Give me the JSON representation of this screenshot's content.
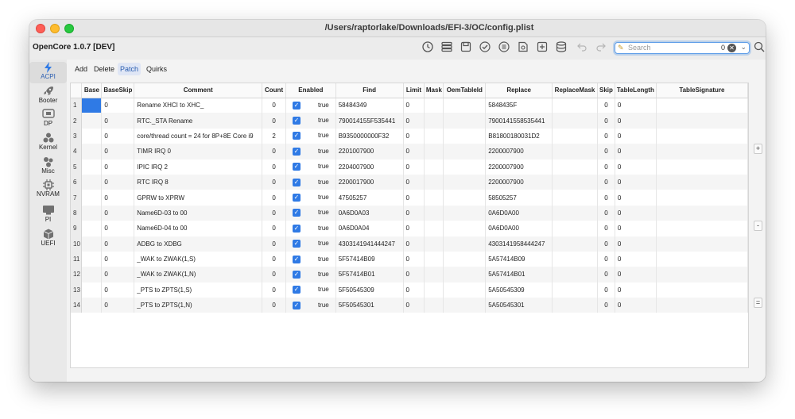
{
  "window": {
    "title": "/Users/raptorlake/Downloads/EFI-3/OC/config.plist"
  },
  "toolbar": {
    "app_name": "OpenCore 1.0.7 [DEV]",
    "icons": [
      "clock-icon",
      "list-icon",
      "save-icon",
      "check-icon",
      "list-circle-icon",
      "document-icon",
      "new-document-icon",
      "database-icon",
      "undo-icon",
      "redo-icon"
    ],
    "search_placeholder": "Search",
    "search_count": "0"
  },
  "sidebar": {
    "items": [
      {
        "label": "ACPI",
        "icon": "lightning-icon",
        "active": true
      },
      {
        "label": "Booter",
        "icon": "rocket-icon",
        "active": false
      },
      {
        "label": "DP",
        "icon": "device-icon",
        "active": false
      },
      {
        "label": "Kernel",
        "icon": "kernel-icon",
        "active": false
      },
      {
        "label": "Misc",
        "icon": "misc-icon",
        "active": false
      },
      {
        "label": "NVRAM",
        "icon": "chip-icon",
        "active": false
      },
      {
        "label": "PI",
        "icon": "platform-icon",
        "active": false
      },
      {
        "label": "UEFI",
        "icon": "cube-icon",
        "active": false
      }
    ]
  },
  "tabs": [
    {
      "label": "Add",
      "active": false
    },
    {
      "label": "Delete",
      "active": false
    },
    {
      "label": "Patch",
      "active": true
    },
    {
      "label": "Quirks",
      "active": false
    }
  ],
  "table": {
    "headers": [
      "",
      "Base",
      "BaseSkip",
      "Comment",
      "Count",
      "Enabled",
      "Find",
      "Limit",
      "Mask",
      "OemTableId",
      "Replace",
      "ReplaceMask",
      "Skip",
      "TableLength",
      "TableSignature"
    ],
    "rows": [
      {
        "n": "1",
        "base": "",
        "baseskip": "0",
        "comment": "Rename XHCI to XHC_",
        "count": "0",
        "enabled": "true",
        "find": "58484349",
        "limit": "0",
        "replace": "5848435F",
        "skip": "0",
        "tablelength": "0"
      },
      {
        "n": "2",
        "base": "",
        "baseskip": "0",
        "comment": "RTC._STA Rename",
        "count": "0",
        "enabled": "true",
        "find": "790014155F535441",
        "limit": "0",
        "replace": "7900141558535441",
        "skip": "0",
        "tablelength": "0"
      },
      {
        "n": "3",
        "base": "",
        "baseskip": "0",
        "comment": "core/thread count = 24 for 8P+8E Core i9",
        "count": "2",
        "enabled": "true",
        "find": "B9350000000F32",
        "limit": "0",
        "replace": "B81800180031D2",
        "skip": "0",
        "tablelength": "0"
      },
      {
        "n": "4",
        "base": "",
        "baseskip": "0",
        "comment": "TIMR IRQ 0",
        "count": "0",
        "enabled": "true",
        "find": "2201007900",
        "limit": "0",
        "replace": "2200007900",
        "skip": "0",
        "tablelength": "0"
      },
      {
        "n": "5",
        "base": "",
        "baseskip": "0",
        "comment": "IPIC IRQ 2",
        "count": "0",
        "enabled": "true",
        "find": "2204007900",
        "limit": "0",
        "replace": "2200007900",
        "skip": "0",
        "tablelength": "0"
      },
      {
        "n": "6",
        "base": "",
        "baseskip": "0",
        "comment": "RTC IRQ 8",
        "count": "0",
        "enabled": "true",
        "find": "2200017900",
        "limit": "0",
        "replace": "2200007900",
        "skip": "0",
        "tablelength": "0"
      },
      {
        "n": "7",
        "base": "",
        "baseskip": "0",
        "comment": "GPRW to XPRW",
        "count": "0",
        "enabled": "true",
        "find": "47505257",
        "limit": "0",
        "replace": "58505257",
        "skip": "0",
        "tablelength": "0"
      },
      {
        "n": "8",
        "base": "",
        "baseskip": "0",
        "comment": "Name6D-03 to 00",
        "count": "0",
        "enabled": "true",
        "find": "0A6D0A03",
        "limit": "0",
        "replace": "0A6D0A00",
        "skip": "0",
        "tablelength": "0"
      },
      {
        "n": "9",
        "base": "",
        "baseskip": "0",
        "comment": "Name6D-04 to 00",
        "count": "0",
        "enabled": "true",
        "find": "0A6D0A04",
        "limit": "0",
        "replace": "0A6D0A00",
        "skip": "0",
        "tablelength": "0"
      },
      {
        "n": "10",
        "base": "",
        "baseskip": "0",
        "comment": "ADBG to XDBG",
        "count": "0",
        "enabled": "true",
        "find": "4303141941444247",
        "limit": "0",
        "replace": "4303141958444247",
        "skip": "0",
        "tablelength": "0"
      },
      {
        "n": "11",
        "base": "",
        "baseskip": "0",
        "comment": "_WAK to ZWAK(1,S)",
        "count": "0",
        "enabled": "true",
        "find": "5F57414B09",
        "limit": "0",
        "replace": "5A57414B09",
        "skip": "0",
        "tablelength": "0"
      },
      {
        "n": "12",
        "base": "",
        "baseskip": "0",
        "comment": "_WAK to ZWAK(1,N)",
        "count": "0",
        "enabled": "true",
        "find": "5F57414B01",
        "limit": "0",
        "replace": "5A57414B01",
        "skip": "0",
        "tablelength": "0"
      },
      {
        "n": "13",
        "base": "",
        "baseskip": "0",
        "comment": "_PTS to ZPTS(1,S)",
        "count": "0",
        "enabled": "true",
        "find": "5F50545309",
        "limit": "0",
        "replace": "5A50545309",
        "skip": "0",
        "tablelength": "0"
      },
      {
        "n": "14",
        "base": "",
        "baseskip": "0",
        "comment": "_PTS to ZPTS(1,N)",
        "count": "0",
        "enabled": "true",
        "find": "5F50545301",
        "limit": "0",
        "replace": "5A50545301",
        "skip": "0",
        "tablelength": "0"
      }
    ]
  },
  "side_buttons": [
    "+",
    "-",
    "="
  ],
  "colors": {
    "accent": "#2f7ae5",
    "close": "#fe5f57",
    "minimize": "#febc2e",
    "maximize": "#28c840"
  }
}
